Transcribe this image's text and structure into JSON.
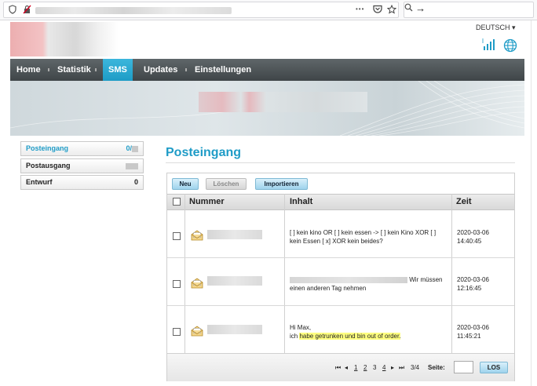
{
  "browser": {
    "icons": [
      "shield-icon",
      "insecure-lock-icon",
      "more-icon",
      "pocket-icon",
      "bookmark-star-icon",
      "search-icon",
      "arrow-right-icon"
    ],
    "more_glyph": "•••",
    "go_glyph": "→"
  },
  "header": {
    "language": "DEUTSCH ▾"
  },
  "nav": {
    "items": [
      {
        "label": "Home"
      },
      {
        "label": "Statistik"
      },
      {
        "label": "SMS"
      },
      {
        "label": "Updates"
      },
      {
        "label": "Einstellungen"
      }
    ],
    "active": "SMS"
  },
  "sidebar": {
    "items": [
      {
        "label": "Posteingang",
        "count": "0/"
      },
      {
        "label": "Postausgang",
        "count": ""
      },
      {
        "label": "Entwurf",
        "count": "0"
      }
    ]
  },
  "main": {
    "title": "Posteingang",
    "buttons": {
      "new": "Neu",
      "delete": "Löschen",
      "import": "Importieren"
    },
    "columns": {
      "number": "Nummer",
      "content": "Inhalt",
      "time": "Zeit"
    },
    "messages": [
      {
        "content_line1": "[ ] kein kino OR  [ ] kein essen -> [ ] kein Kino XOR [ ]",
        "content_line2": "kein Essen [ x]  XOR kein beides?",
        "date": "2020-03-06",
        "time": "14:40:45"
      },
      {
        "content_tail": "Wir müssen",
        "content_line2": "einen anderen Tag nehmen",
        "date": "2020-03-06",
        "time": "12:16:45"
      },
      {
        "content_line1": "Hi Max,",
        "content_prefix": "ich ",
        "content_highlight": "habe getrunken und bin out of order.",
        "date": "2020-03-06",
        "time": "11:45:21"
      }
    ],
    "pager": {
      "first": "⏮",
      "prev": "◂",
      "pages": [
        "1",
        "2",
        "3",
        "4"
      ],
      "next": "▸",
      "last": "⏭",
      "status": "3/4",
      "page_label": "Seite:",
      "go": "LOS"
    }
  },
  "colors": {
    "accent": "#1f9cc7",
    "nav_bg": "#4a5053",
    "highlight": "#ffff80"
  }
}
